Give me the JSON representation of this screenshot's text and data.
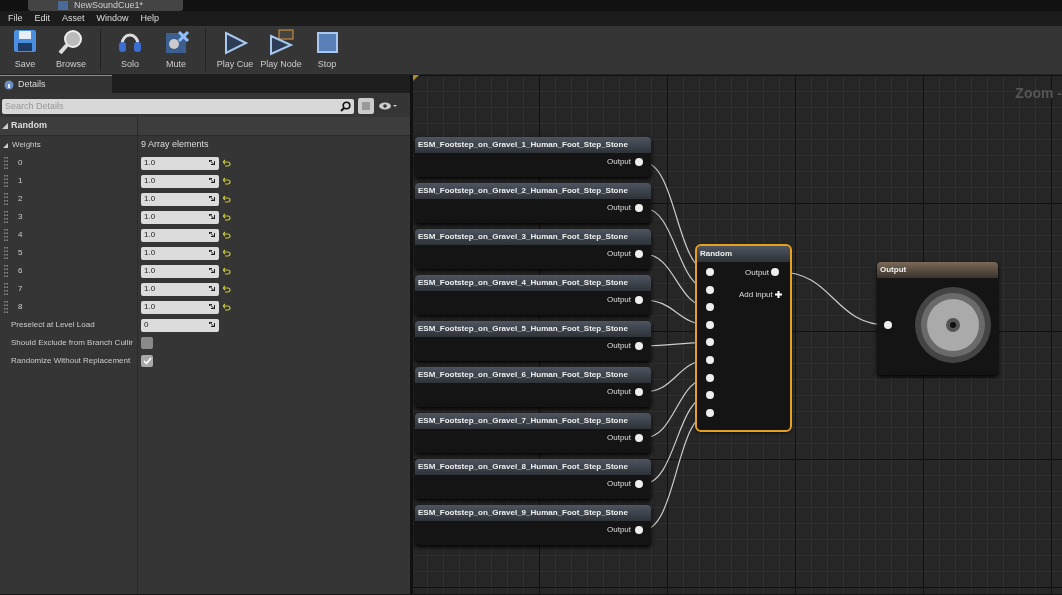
{
  "document_tab": {
    "title": "NewSoundCue1*"
  },
  "menu": [
    "File",
    "Edit",
    "Asset",
    "Window",
    "Help"
  ],
  "toolbar": [
    {
      "kind": "save",
      "label": "Save"
    },
    {
      "kind": "browse",
      "label": "Browse"
    },
    {
      "kind": "solo",
      "label": "Solo"
    },
    {
      "kind": "mute",
      "label": "Mute"
    },
    {
      "kind": "play",
      "label": "Play Cue"
    },
    {
      "kind": "playnode",
      "label": "Play Node"
    },
    {
      "kind": "stop",
      "label": "Stop"
    }
  ],
  "details": {
    "tab": "Details",
    "search": {
      "placeholder": "Search Details"
    },
    "category": "Random",
    "weights": {
      "label": "Weights",
      "summary": "9 Array elements",
      "expanded": true,
      "items": [
        {
          "index": "0",
          "value": "1.0"
        },
        {
          "index": "1",
          "value": "1.0"
        },
        {
          "index": "2",
          "value": "1.0"
        },
        {
          "index": "3",
          "value": "1.0"
        },
        {
          "index": "4",
          "value": "1.0"
        },
        {
          "index": "5",
          "value": "1.0"
        },
        {
          "index": "6",
          "value": "1.0"
        },
        {
          "index": "7",
          "value": "1.0"
        },
        {
          "index": "8",
          "value": "1.0"
        }
      ]
    },
    "properties": [
      {
        "kind": "number",
        "label": "Preselect at Level Load",
        "value": "0"
      },
      {
        "kind": "checkbox",
        "label": "Should Exclude from Branch Cullir",
        "checked": false
      },
      {
        "kind": "checkbox",
        "label": "Randomize Without Replacement",
        "checked": true
      }
    ]
  },
  "graph": {
    "zoom": "Zoom -",
    "wave_players": [
      {
        "title": "ESM_Footstep_on_Gravel_1_Human_Foot_Step_Stone",
        "output": "Output"
      },
      {
        "title": "ESM_Footstep_on_Gravel_2_Human_Foot_Step_Stone",
        "output": "Output"
      },
      {
        "title": "ESM_Footstep_on_Gravel_3_Human_Foot_Step_Stone",
        "output": "Output"
      },
      {
        "title": "ESM_Footstep_on_Gravel_4_Human_Foot_Step_Stone",
        "output": "Output"
      },
      {
        "title": "ESM_Footstep_on_Gravel_5_Human_Foot_Step_Stone",
        "output": "Output"
      },
      {
        "title": "ESM_Footstep_on_Gravel_6_Human_Foot_Step_Stone",
        "output": "Output"
      },
      {
        "title": "ESM_Footstep_on_Gravel_7_Human_Foot_Step_Stone",
        "output": "Output"
      },
      {
        "title": "ESM_Footstep_on_Gravel_8_Human_Foot_Step_Stone",
        "output": "Output"
      },
      {
        "title": "ESM_Footstep_on_Gravel_9_Human_Foot_Step_Stone",
        "output": "Output"
      }
    ],
    "random": {
      "title": "Random",
      "output": "Output",
      "add_input": "Add input",
      "selected": true
    },
    "output_node": {
      "title": "Output"
    }
  }
}
